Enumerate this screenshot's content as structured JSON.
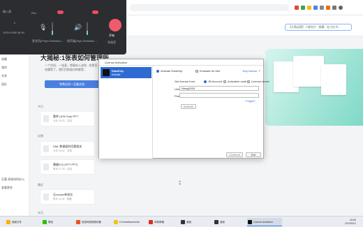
{
  "browser": {
    "search_placeholder": "【大角运营】人物名片 - 收藏 - 在小红书..."
  },
  "recorder": {
    "left_label": "输入源",
    "rec_label": "Rec",
    "mic_label": "麦克风(FHgH Definition ...",
    "speaker_label": "扬声器(High Definition ...",
    "res": "1920×1080 @ 60",
    "gain": "0",
    "rec_button": "开始",
    "sub_label": "系统音"
  },
  "page": {
    "hero_title": "大揭秘:1张表如何管理所",
    "hero_text": "一个空间，一张表，将事务入进到...你是否也遇到了，我们目前面对的都是...",
    "hero_button": "免费试用一石墨文档",
    "section_recent": "近期",
    "section_last7": "最近",
    "section_today": "今日",
    "section_month": "本月"
  },
  "files": [
    {
      "title": "题库 (ATA Grip) PPT",
      "sub": "今天 10:24 · 文档"
    },
    {
      "title": "DML 数据面的问题相关",
      "sub": "今天 09:02 · 文档"
    },
    {
      "title": "幕缝ICQ (PPT PPT)",
      "sub": "昨天 17:33 · 文档"
    },
    {
      "title": "石vocabr单测试",
      "sub": "昨天 11:06 · 表格"
    }
  ],
  "leftnav": [
    "主页",
    "最近",
    "收藏",
    "我的",
    "共享",
    "团队"
  ],
  "leftnav_bottom": [
    "石墨 高效协同办公",
    "查看更多"
  ],
  "dialog": {
    "title": "License Activation",
    "product_name": "DataGrip",
    "product_status": "Activate",
    "opt_activate": "Activate DataGrip",
    "opt_evaluate": "Evaluate for free",
    "buy_link": "Buy license ↗",
    "get_license_label": "Get license from:",
    "src_account": "JB Account",
    "src_code": "Activation code",
    "src_server": "License server",
    "username_label": "Username / email:",
    "username_value": "Wang3003",
    "password_label": "Password:",
    "forgot": "Forgot?",
    "activate_btn": "Activate",
    "continue_btn": "Continue",
    "exit_btn": "Exit"
  },
  "taskbar": {
    "items": [
      "桌面文件",
      "微信",
      "信息网络视频设备",
      "D:\\Installwaresetdr",
      "网易邮箱",
      "桌面",
      "桌面",
      "License Activation"
    ],
    "time": "16:08",
    "date": "2023/9/19"
  }
}
